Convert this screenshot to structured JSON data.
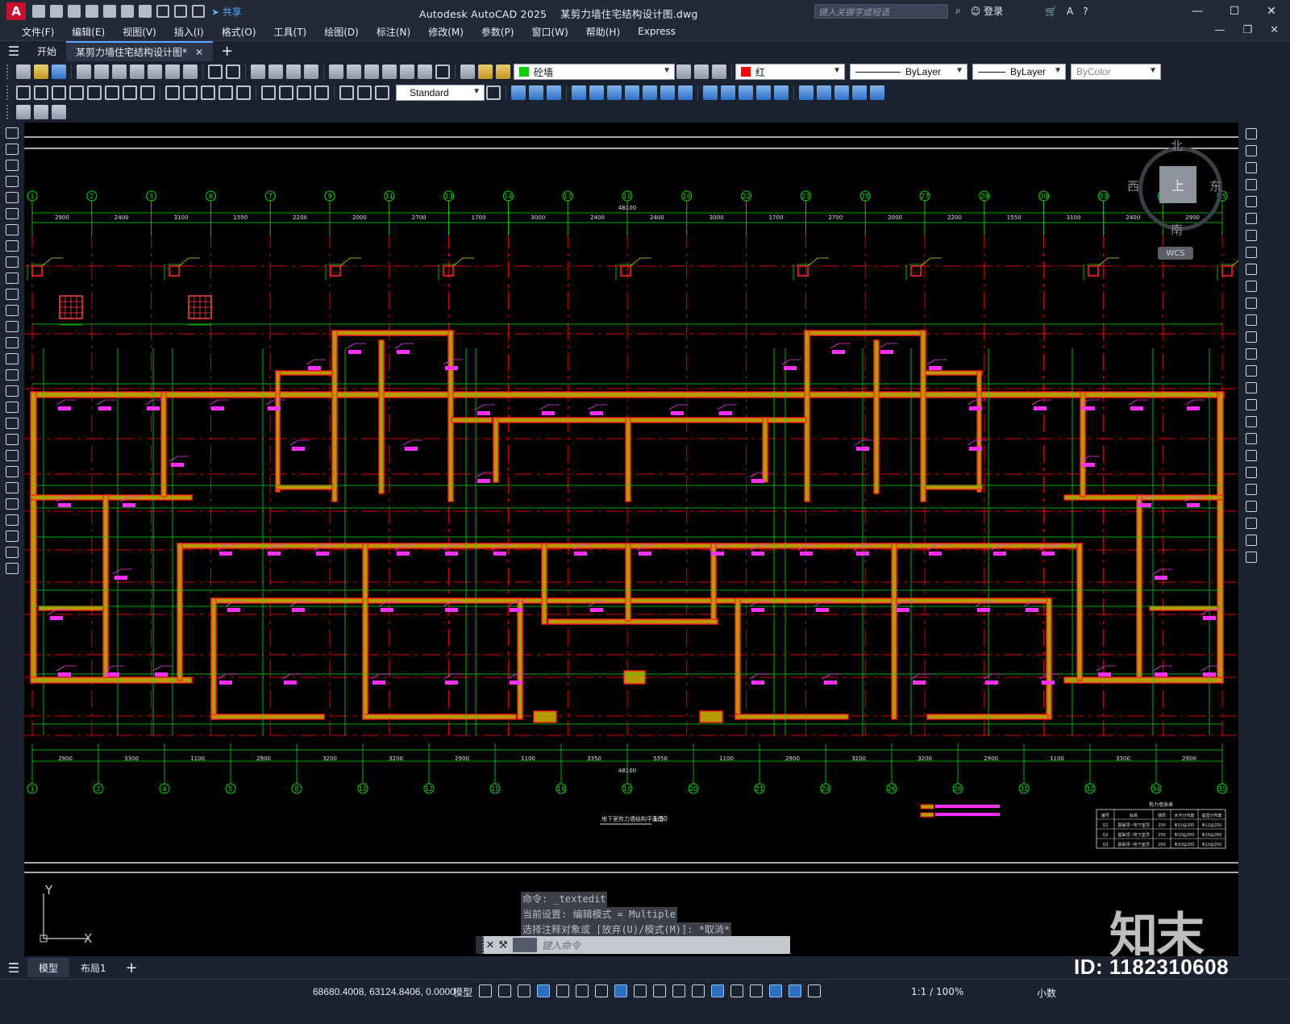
{
  "window": {
    "app_title": "Autodesk AutoCAD 2025",
    "file_name": "某剪力墙住宅结构设计图.dwg",
    "search_placeholder": "键入关键字或短语",
    "login": "登录",
    "share": "共享",
    "app_logo": "A"
  },
  "menu": [
    "文件(F)",
    "编辑(E)",
    "视图(V)",
    "插入(I)",
    "格式(O)",
    "工具(T)",
    "绘图(D)",
    "标注(N)",
    "修改(M)",
    "参数(P)",
    "窗口(W)",
    "帮助(H)",
    "Express"
  ],
  "tabs": {
    "start": "开始",
    "document": "某剪力墙住宅结构设计图*"
  },
  "properties": {
    "layer": "砼墙",
    "color": "红",
    "color_hex": "#ff0000",
    "linetype": "ByLayer",
    "lineweight": "ByLayer",
    "plotstyle": "ByColor",
    "text_style": "Standard"
  },
  "viewcube": {
    "north": "北",
    "south": "南",
    "west": "西",
    "east": "东",
    "face": "上",
    "wcs": "WCS"
  },
  "drawing": {
    "top_axes": [
      "1",
      "2",
      "3",
      "6",
      "7",
      "9",
      "11",
      "13",
      "14",
      "17",
      "18",
      "19",
      "22",
      "23",
      "25",
      "27",
      "29",
      "30",
      "33",
      "34",
      "35"
    ],
    "top_dims": [
      "2900",
      "2400",
      "3100",
      "1550",
      "2200",
      "2000",
      "2700",
      "1700",
      "3000",
      "2400",
      "2400",
      "3000",
      "1700",
      "2700",
      "2000",
      "2200",
      "1550",
      "3100",
      "2400",
      "2900"
    ],
    "top_total": "48100",
    "bottom_axes": [
      "1",
      "2",
      "4",
      "5",
      "8",
      "10",
      "12",
      "15",
      "16",
      "18",
      "20",
      "21",
      "24",
      "26",
      "28",
      "31",
      "32",
      "34",
      "35"
    ],
    "bottom_dims": [
      "2900",
      "3300",
      "1100",
      "2900",
      "3200",
      "3200",
      "2900",
      "1100",
      "3350",
      "5350",
      "1100",
      "2900",
      "3200",
      "3200",
      "2900",
      "1100",
      "3300",
      "2900"
    ],
    "bottom_total": "48100",
    "drawing_title": "地下室剪力墙结构平面图",
    "drawing_scale": "1:50",
    "table_title": "剪力墙身表",
    "table_headers": [
      "编号",
      "标高",
      "墙厚",
      "水平分布筋",
      "垂直分布筋"
    ],
    "table_rows": [
      [
        "Q1",
        "基础顶~地下室顶",
        "250",
        "Φ12@200",
        "Φ12@200"
      ],
      [
        "Q2",
        "基础顶~地下室顶",
        "250",
        "Φ10@200",
        "Φ10@200"
      ],
      [
        "Q3",
        "基础顶~地下室顶",
        "200",
        "Φ10@200",
        "Φ10@200"
      ]
    ]
  },
  "command": {
    "history": [
      "命令: _textedit",
      "当前设置: 编辑模式 = Multiple",
      "选择注释对象或 [放弃(U)/模式(M)]: *取消*"
    ],
    "placeholder": "键入命令"
  },
  "layouts": [
    "模型",
    "布局1"
  ],
  "status": {
    "coords": "68680.4008, 63124.8406, 0.0000",
    "space": "模型",
    "scale": "1:1 / 100%",
    "units": "小数"
  },
  "watermark": {
    "brand": "知末",
    "id": "ID: 1182310608"
  }
}
